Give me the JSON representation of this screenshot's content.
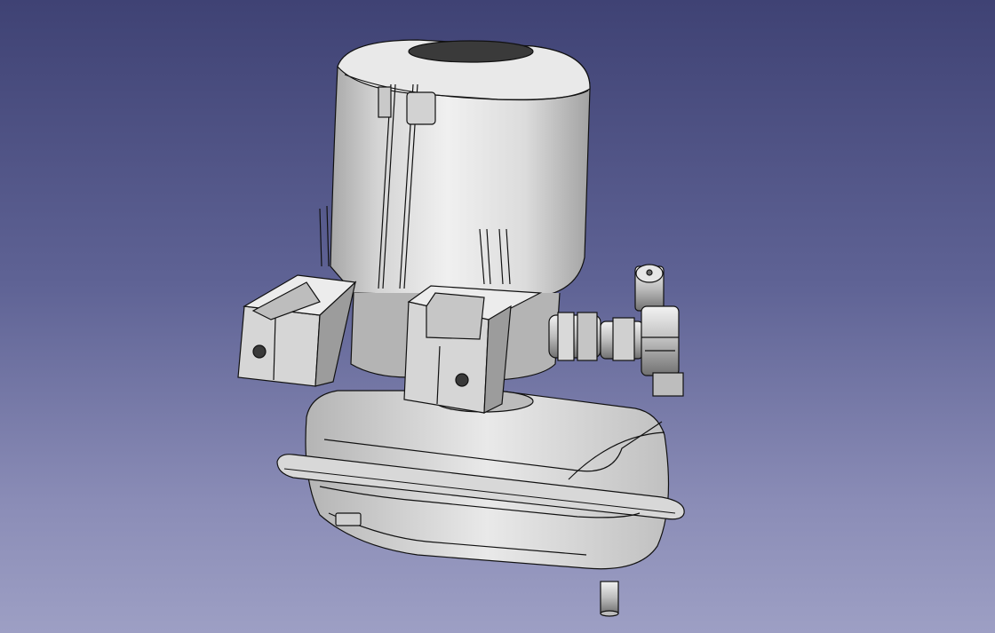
{
  "viewport": {
    "background_top": "#3f4274",
    "background_bottom": "#9d9fc4"
  },
  "model": {
    "parts": [
      "motor-housing",
      "mounting-bracket",
      "pipe-fitting",
      "valve",
      "reservoir-tank",
      "tank-outlet"
    ],
    "colors": {
      "body_light": "#ececec",
      "body_mid": "#bdbdbd",
      "body_dark": "#7a7a7a",
      "edge": "#111111"
    }
  }
}
